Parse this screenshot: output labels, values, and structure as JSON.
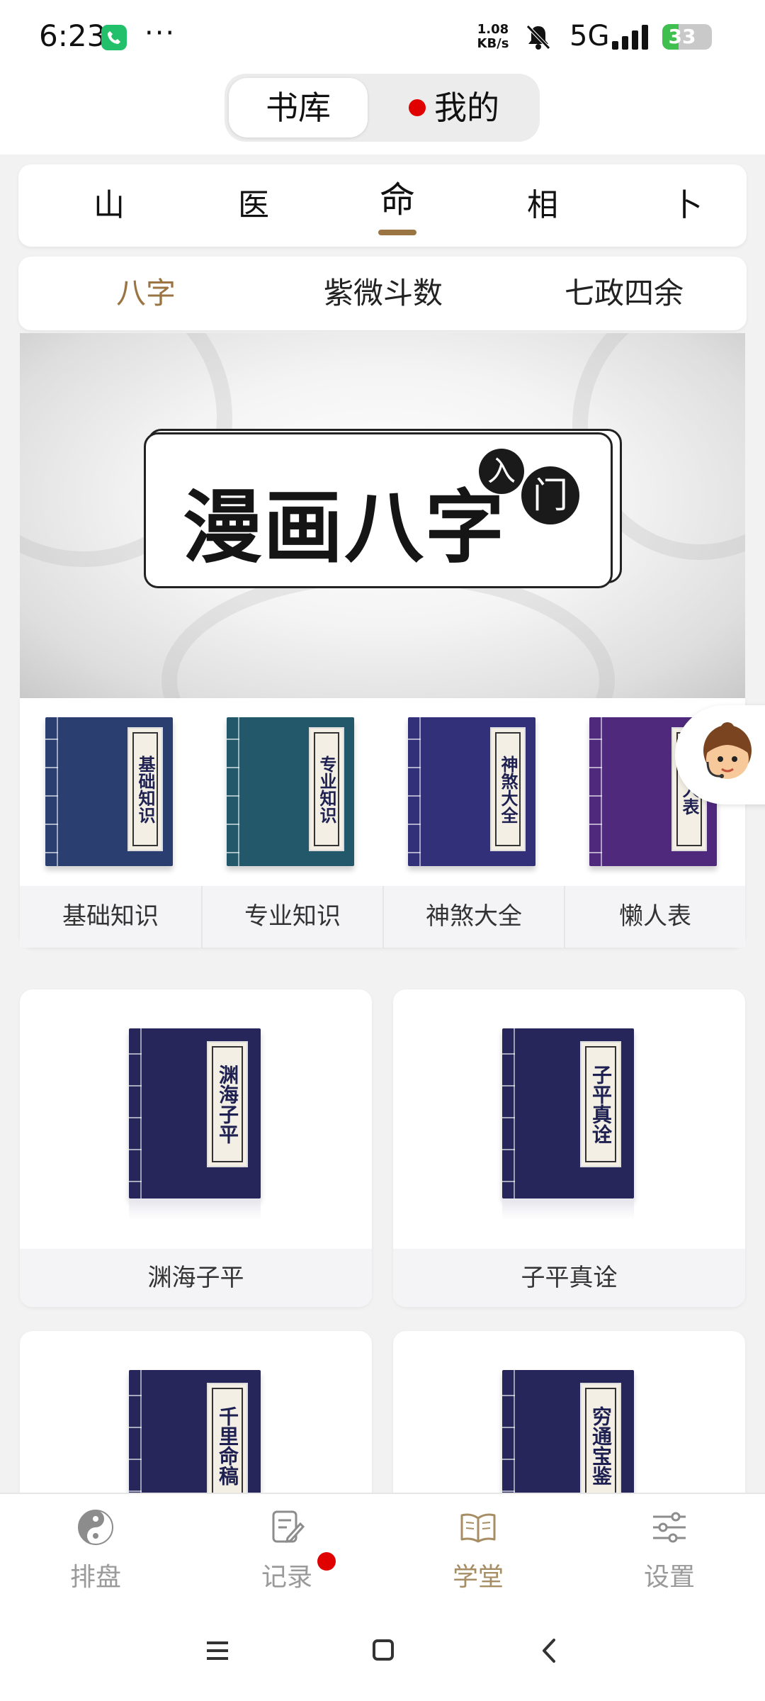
{
  "status_bar": {
    "time": "6:23",
    "dots": "···",
    "speed_top": "1.08",
    "speed_bottom": "KB/s",
    "network": "5G",
    "battery": "33",
    "battery_level_percent": 33,
    "call_color": "#22c06a"
  },
  "header": {
    "tabs": [
      {
        "label": "书库",
        "active": true
      },
      {
        "label": "我的",
        "active": false,
        "badge": true
      }
    ]
  },
  "categories": {
    "items": [
      "山",
      "医",
      "命",
      "相",
      "卜"
    ],
    "active": "命"
  },
  "subcategories": {
    "items": [
      "八字",
      "紫微斗数",
      "七政四余"
    ],
    "active": "八字"
  },
  "banner": {
    "title": "漫画八字",
    "badge_1": "入",
    "badge_2": "门"
  },
  "shelf": {
    "items": [
      {
        "label": "基础知识",
        "cover_text": "基础知识",
        "color": "#2a3f6f"
      },
      {
        "label": "专业知识",
        "cover_text": "专业知识",
        "color": "#22586a"
      },
      {
        "label": "神煞大全",
        "cover_text": "神煞大全",
        "color": "#33307a"
      },
      {
        "label": "懒人表",
        "cover_text": "懒人表",
        "color": "#4f2a7c"
      }
    ]
  },
  "books": [
    {
      "title": "渊海子平",
      "cover_text": "渊海子平"
    },
    {
      "title": "子平真诠",
      "cover_text": "子平真诠"
    },
    {
      "title": "",
      "cover_text": "千里命稿"
    },
    {
      "title": "",
      "cover_text": "穷通宝鉴"
    }
  ],
  "bottom_nav": {
    "items": [
      {
        "label": "排盘",
        "icon": "yinyang-icon",
        "active": false
      },
      {
        "label": "记录",
        "icon": "note-edit-icon",
        "active": false,
        "badge": true
      },
      {
        "label": "学堂",
        "icon": "open-book-icon",
        "active": true
      },
      {
        "label": "设置",
        "icon": "sliders-icon",
        "active": false
      }
    ]
  },
  "colors": {
    "accent": "#9a7442",
    "book_navy": "#26265a",
    "badge_red": "#e00000"
  }
}
